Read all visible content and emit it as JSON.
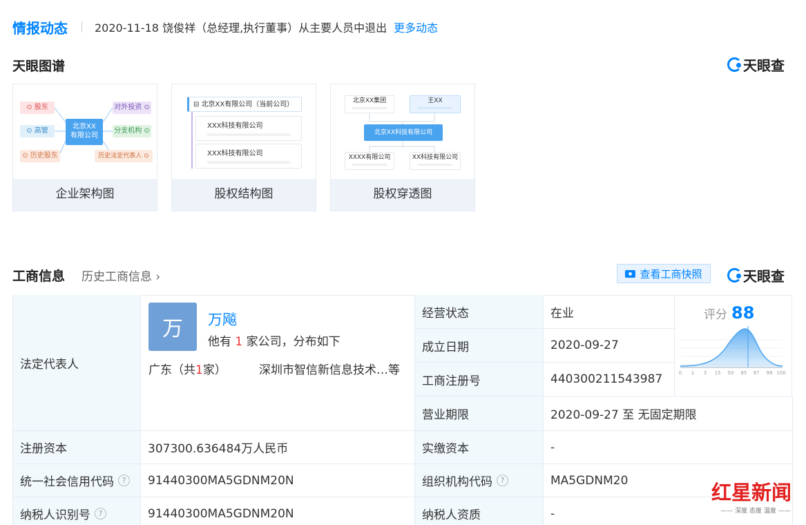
{
  "news": {
    "title": "情报动态",
    "text": "2020-11-18  饶俊祥（总经理,执行董事）从主要人员中退出",
    "more": "更多动态"
  },
  "atlas": {
    "title": "天眼图谱",
    "brand": "天眼查",
    "cards": [
      {
        "label": "企业架构图",
        "center": "北京XX\n有限公司",
        "nodes": [
          "股东",
          "高管",
          "历史股东",
          "对外投资",
          "分支机构",
          "历史法定代表人"
        ]
      },
      {
        "label": "股权结构图",
        "root": "北京XX有限公司（当前公司）",
        "children": [
          "XXX科技有限公司",
          "XXX科技有限公司"
        ]
      },
      {
        "label": "股权穿透图",
        "top": [
          "北京XX集团",
          "王XX"
        ],
        "center": "北京XX科技有限公司",
        "bottom": [
          "XXXX有限公司",
          "XX科技有限公司"
        ]
      }
    ]
  },
  "business": {
    "title": "工商信息",
    "history": "历史工商信息",
    "snapshot": "查看工商快照",
    "brand": "天眼查",
    "legal_rep_label": "法定代表人",
    "rep": {
      "avatar": "万",
      "name": "万飚",
      "desc_prefix": "他有 ",
      "count": "1",
      "desc_suffix": " 家公司，分布如下",
      "region_prefix": "广东（共",
      "region_count": "1",
      "region_suffix": "家）",
      "company": "深圳市智信新信息技术…等"
    },
    "status_label": "经营状态",
    "status": "在业",
    "est_label": "成立日期",
    "est": "2020-09-27",
    "reg_no_label": "工商注册号",
    "reg_no": "440300211543987",
    "term_label": "营业期限",
    "term": "2020-09-27  至 无固定期限",
    "score_label": "评分",
    "score": "88",
    "score_axis": [
      "0",
      "1",
      "3",
      "15",
      "50",
      "85",
      "97",
      "99",
      "100"
    ],
    "capital_label": "注册资本",
    "capital": "307300.636484万人民币",
    "paid_label": "实缴资本",
    "paid": "-",
    "credit_label": "统一社会信用代码",
    "credit": "91440300MA5GDNM20N",
    "org_label": "组织机构代码",
    "org": "MA5GDNM20",
    "tax_label": "纳税人识别号",
    "tax": "91440300MA5GDNM20N",
    "taxq_label": "纳税人资质",
    "taxq": "-",
    "help_glyph": "?"
  },
  "watermark": {
    "main": "红星新闻",
    "sub": "—— 深度 态度 温度 ——"
  },
  "colors": {
    "accent": "#0084ff",
    "label_bg": "#f2f9fc",
    "highlight": "#f03030"
  }
}
